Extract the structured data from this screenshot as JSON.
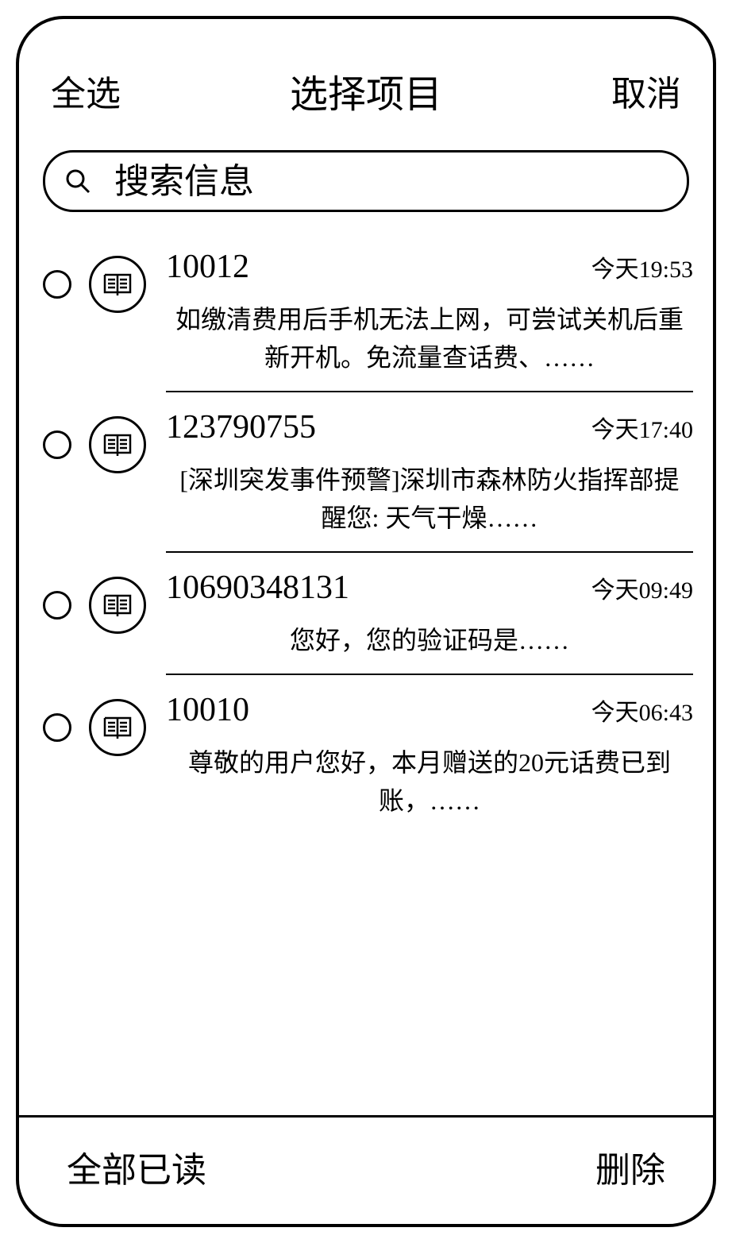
{
  "header": {
    "select_all": "全选",
    "title": "选择项目",
    "cancel": "取消"
  },
  "search": {
    "placeholder": "搜索信息"
  },
  "messages": [
    {
      "sender": "10012",
      "timestamp": "今天19:53",
      "preview": "如缴清费用后手机无法上网，可尝试关机后重新开机。免流量查话费、……"
    },
    {
      "sender": "123790755",
      "timestamp": "今天17:40",
      "preview": "[深圳突发事件预警]深圳市森林防火指挥部提醒您: 天气干燥……"
    },
    {
      "sender": "10690348131",
      "timestamp": "今天09:49",
      "preview": "您好，您的验证码是……"
    },
    {
      "sender": "10010",
      "timestamp": "今天06:43",
      "preview": "尊敬的用户您好，本月赠送的20元话费已到账，……"
    }
  ],
  "footer": {
    "mark_read": "全部已读",
    "delete": "删除"
  }
}
